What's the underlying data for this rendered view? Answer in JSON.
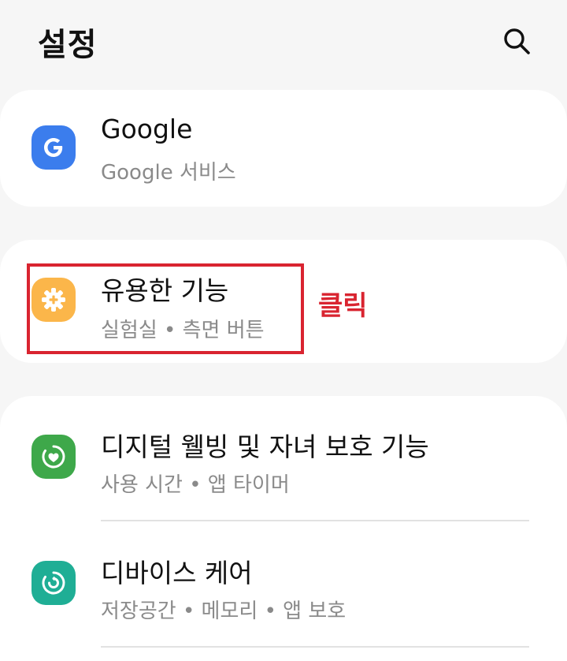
{
  "header": {
    "title": "설정",
    "search_icon": "search-icon"
  },
  "items": [
    {
      "title": "Google",
      "subtitle": "Google 서비스",
      "icon": "google-icon",
      "icon_color": "#3b7ded"
    },
    {
      "title": "유용한 기능",
      "subtitle": "실험실 • 측면 버튼",
      "icon": "plus-gear-icon",
      "icon_color": "#fbb64a"
    },
    {
      "title": "디지털 웰빙 및 자녀 보호 기능",
      "subtitle": "사용 시간 • 앱 타이머",
      "icon": "wellbeing-heart-icon",
      "icon_color": "#3ea84a"
    },
    {
      "title": "디바이스 케어",
      "subtitle": "저장공간 • 메모리 • 앱 보호",
      "icon": "device-care-icon",
      "icon_color": "#1fae95"
    }
  ],
  "annotation": {
    "label": "클릭",
    "color": "#d92430"
  }
}
